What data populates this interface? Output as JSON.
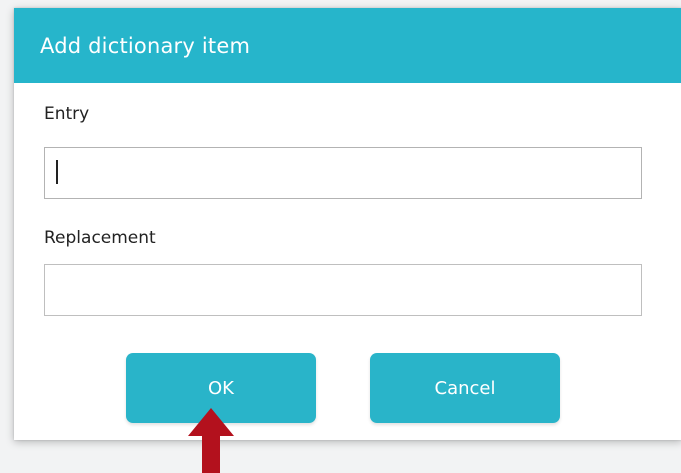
{
  "dialog": {
    "title": "Add dictionary item",
    "entry_label": "Entry",
    "entry_value": "",
    "replacement_label": "Replacement",
    "replacement_value": "",
    "ok_label": "OK",
    "cancel_label": "Cancel"
  },
  "colors": {
    "accent": "#26b5cb",
    "button": "#29b4c9",
    "arrow": "#b3111d"
  },
  "annotation": {
    "icon": "arrow-up-icon"
  }
}
